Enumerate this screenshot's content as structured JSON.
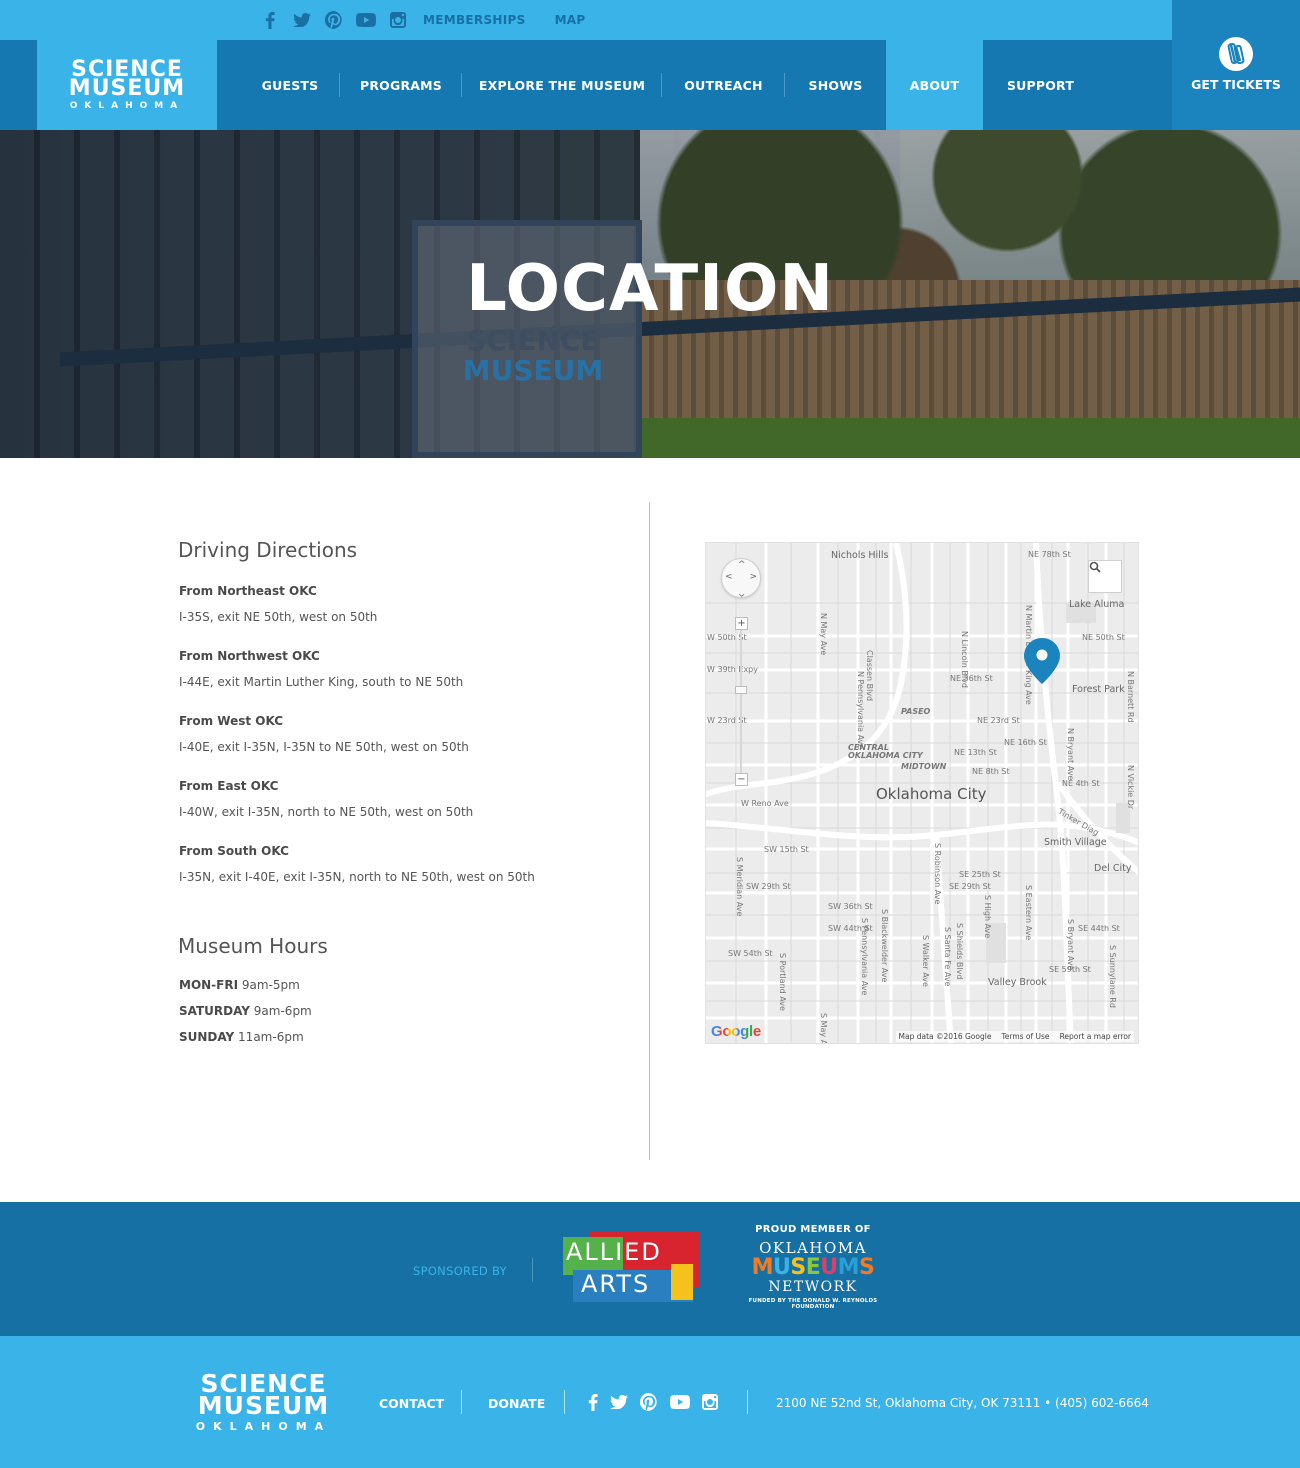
{
  "header": {
    "social_icons": [
      "facebook-icon",
      "twitter-icon",
      "pinterest-icon",
      "youtube-icon",
      "instagram-icon"
    ],
    "top_links": [
      "MEMBERSHIPS",
      "MAP"
    ],
    "logo": {
      "line1": "SCIENCE",
      "line2": "MUSEUM",
      "line3": "OKLAHOMA"
    },
    "nav": [
      "GUESTS",
      "PROGRAMS",
      "EXPLORE THE MUSEUM",
      "OUTREACH",
      "SHOWS",
      "ABOUT",
      "SUPPORT"
    ],
    "active_nav": "ABOUT",
    "tickets_label": "GET TICKETS"
  },
  "hero": {
    "title": "LOCATION",
    "sign_line1": "SCIENCE",
    "sign_line2": "MUSEUM"
  },
  "directions": {
    "heading": "Driving Directions",
    "items": [
      {
        "title": "From Northeast OKC",
        "text": "I-35S, exit NE 50th, west on 50th"
      },
      {
        "title": "From Northwest OKC",
        "text": "I-44E, exit Martin Luther King, south to NE 50th"
      },
      {
        "title": "From West OKC",
        "text": "I-40E, exit I-35N, I-35N to NE 50th, west on 50th"
      },
      {
        "title": "From East OKC",
        "text": "I-40W, exit I-35N, north to NE 50th, west on 50th"
      },
      {
        "title": "From South OKC",
        "text": "I-35N, exit I-40E, exit I-35N, north to NE 50th, west on 50th"
      }
    ]
  },
  "hours": {
    "heading": "Museum Hours",
    "rows": [
      {
        "day": "MON-FRI",
        "time": "9am-5pm"
      },
      {
        "day": "SATURDAY",
        "time": "9am-6pm"
      },
      {
        "day": "SUNDAY",
        "time": "11am-6pm"
      }
    ]
  },
  "map": {
    "city_label": "Oklahoma City",
    "places": [
      "Nichols Hills",
      "Lake Aluma",
      "Forest Park",
      "Smith Village",
      "Del City",
      "Valley Brook",
      "PASEO",
      "CENTRAL",
      "OKLAHOMA CITY",
      "MIDTOWN"
    ],
    "streets": [
      "NE 78th St",
      "NE 50th St",
      "NE 36th St",
      "NE 23rd St",
      "NE 16th St",
      "NE 13th St",
      "NE 8th St",
      "NE 4th St",
      "W 50th St",
      "W 39th Expy",
      "W 23rd St",
      "W Reno Ave",
      "SW 15th St",
      "SW 29th St",
      "SW 36th St",
      "SW 44th St",
      "SW 54th St",
      "SE 25th St",
      "SE 29th St",
      "SE 44th St",
      "SE 59th St",
      "Classen Blvd",
      "N Lincoln Blvd",
      "N Martin Luther King Ave",
      "N Pennsylvania Ave",
      "N May Ave",
      "N Bryant Ave",
      "Tinker Diag",
      "N Vickie Dr",
      "N Barnett Rd",
      "S Meridian Ave",
      "S Portland Ave",
      "S Pennsylvania Ave",
      "S Blackwelder Ave",
      "S Walker Ave",
      "S Robinson Ave",
      "S Santa Fe Ave",
      "S Shields Blvd",
      "S High Ave",
      "S Eastern Ave",
      "S Bryant Ave",
      "S Sunnylane Rd",
      "S May Ave"
    ],
    "google_label": "Google",
    "attribution": [
      "Map data ©2016 Google",
      "Terms of Use",
      "Report a map error"
    ],
    "zoom_plus": "+",
    "zoom_minus": "−"
  },
  "sponsors": {
    "label": "SPONSORED BY",
    "allied_line1": "ALLIED",
    "allied_line2": "ARTS",
    "omn_line1": "PROUD MEMBER OF",
    "omn_line2": "OKLAHOMA",
    "omn_line3": "MUSEUMS",
    "omn_line4": "NETWORK",
    "omn_line5": "FUNDED BY THE DONALD W. REYNOLDS FOUNDATION"
  },
  "footer": {
    "logo": {
      "line1": "SCIENCE",
      "line2": "MUSEUM",
      "line3": "OKLAHOMA"
    },
    "links": [
      "CONTACT",
      "DONATE"
    ],
    "social_icons": [
      "facebook-icon",
      "twitter-icon",
      "pinterest-icon",
      "youtube-icon",
      "instagram-icon"
    ],
    "address": "2100 NE 52nd St, Oklahoma City, OK 73111",
    "phone": "(405) 602-6664"
  },
  "colors": {
    "light_blue": "#3ab4e8",
    "dark_blue": "#1578b0",
    "sponsor_blue": "#1670a4",
    "pin_blue": "#1b83be"
  }
}
